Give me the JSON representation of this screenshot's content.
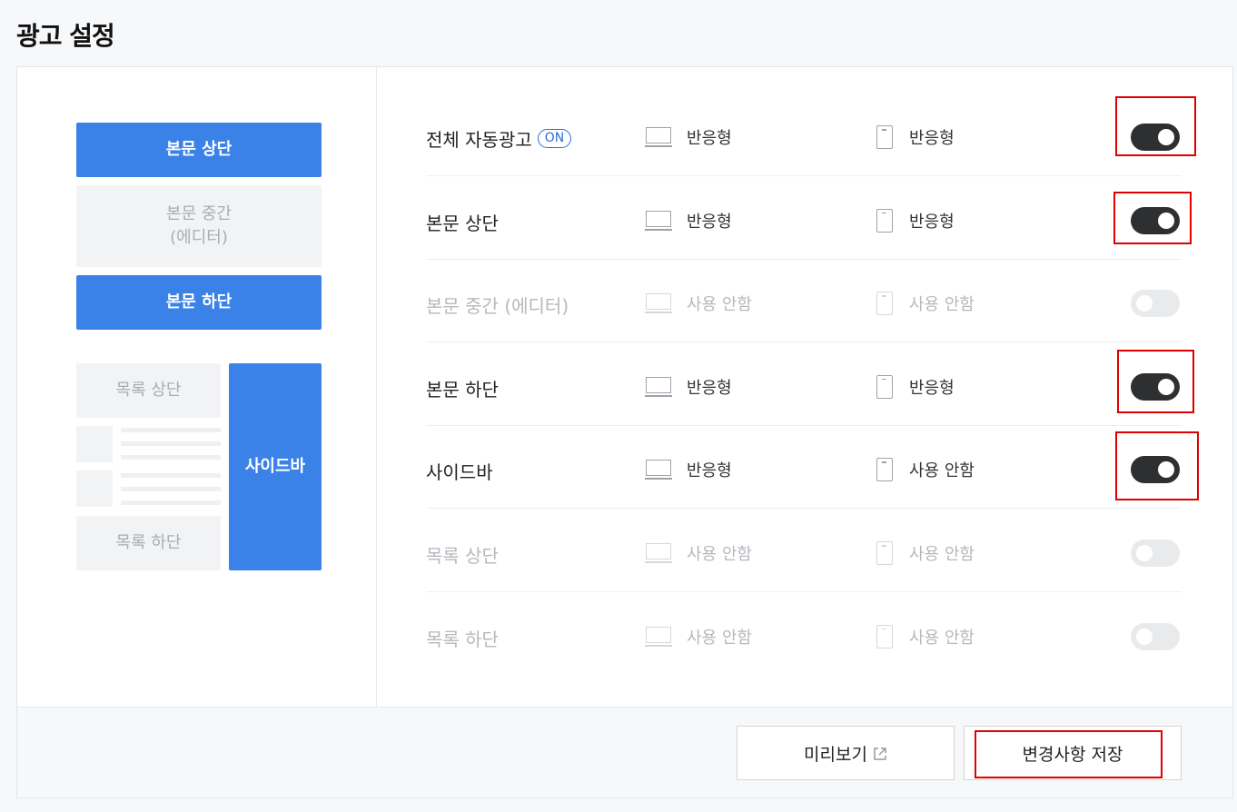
{
  "page": {
    "title": "광고 설정"
  },
  "preview": {
    "top": "본문 상단",
    "middle_line1": "본문 중간",
    "middle_line2": "(에디터)",
    "bottom": "본문 하단",
    "list_top": "목록 상단",
    "list_bottom": "목록 하단",
    "sidebar": "사이드바"
  },
  "rows": [
    {
      "label": "전체 자동광고",
      "badge": "ON",
      "pc": "반응형",
      "mobile": "반응형",
      "enabled": true
    },
    {
      "label": "본문 상단",
      "pc": "반응형",
      "mobile": "반응형",
      "enabled": true
    },
    {
      "label": "본문 중간 (에디터)",
      "pc": "사용 안함",
      "mobile": "사용 안함",
      "enabled": false
    },
    {
      "label": "본문 하단",
      "pc": "반응형",
      "mobile": "반응형",
      "enabled": true
    },
    {
      "label": "사이드바",
      "pc": "반응형",
      "mobile": "사용 안함",
      "enabled": true
    },
    {
      "label": "목록 상단",
      "pc": "사용 안함",
      "mobile": "사용 안함",
      "enabled": false
    },
    {
      "label": "목록 하단",
      "pc": "사용 안함",
      "mobile": "사용 안함",
      "enabled": false
    }
  ],
  "footer": {
    "preview_label": "미리보기",
    "save_label": "변경사항 저장"
  },
  "colors": {
    "accent": "#3b82e8",
    "toggle_on": "#2e2f31",
    "toggle_off": "#e9eaec",
    "highlight": "#e00000"
  },
  "icons": {
    "pc": "monitor-icon",
    "mobile": "mobile-icon",
    "preview": "external-link-icon"
  }
}
